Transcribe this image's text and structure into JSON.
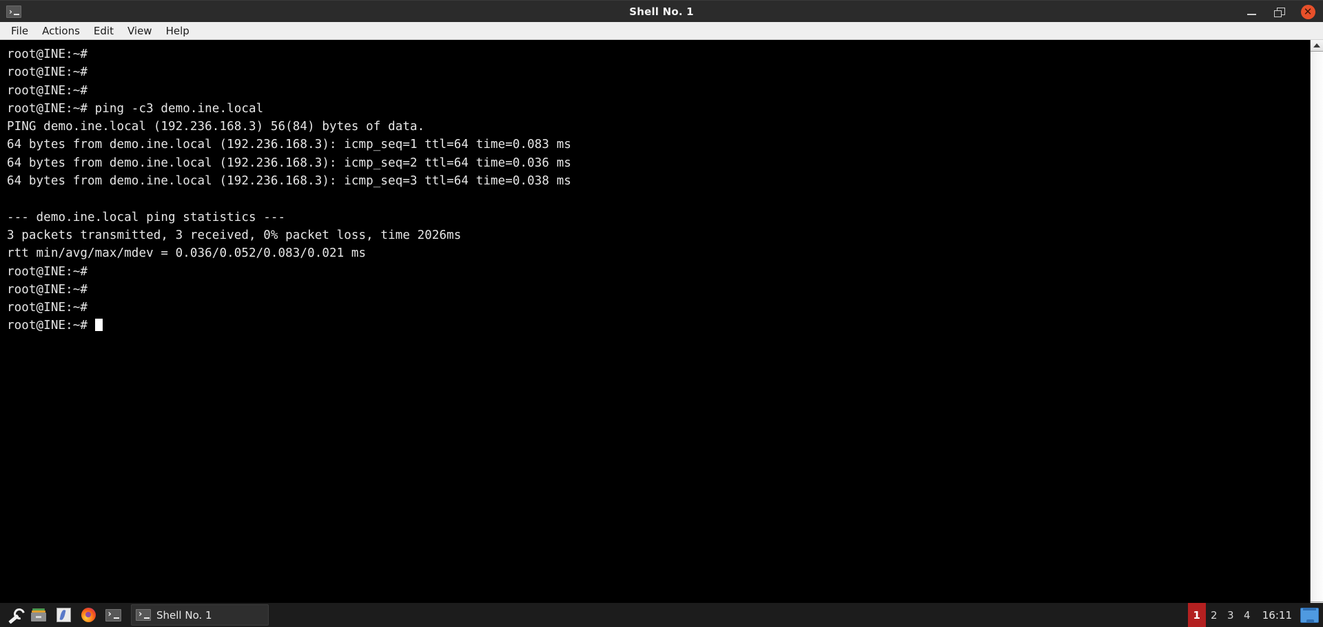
{
  "window": {
    "title": "Shell No. 1",
    "icon": "terminal-icon",
    "controls": {
      "minimize": "–",
      "maximize": "□",
      "close": "✕"
    }
  },
  "menubar": {
    "items": [
      {
        "label": "File"
      },
      {
        "label": "Actions"
      },
      {
        "label": "Edit"
      },
      {
        "label": "View"
      },
      {
        "label": "Help"
      }
    ]
  },
  "terminal": {
    "prompt": "root@INE:~#",
    "lines": [
      "root@INE:~#",
      "root@INE:~#",
      "root@INE:~#",
      "root@INE:~# ping -c3 demo.ine.local",
      "PING demo.ine.local (192.236.168.3) 56(84) bytes of data.",
      "64 bytes from demo.ine.local (192.236.168.3): icmp_seq=1 ttl=64 time=0.083 ms",
      "64 bytes from demo.ine.local (192.236.168.3): icmp_seq=2 ttl=64 time=0.036 ms",
      "64 bytes from demo.ine.local (192.236.168.3): icmp_seq=3 ttl=64 time=0.038 ms",
      "",
      "--- demo.ine.local ping statistics ---",
      "3 packets transmitted, 3 received, 0% packet loss, time 2026ms",
      "rtt min/avg/max/mdev = 0.036/0.052/0.083/0.021 ms",
      "root@INE:~#",
      "root@INE:~#",
      "root@INE:~#"
    ],
    "last_prompt": "root@INE:~# ",
    "cursor": "block"
  },
  "scrollbar": {
    "up_arrow": "scroll-up-icon",
    "down_arrow": "scroll-down-icon"
  },
  "taskbar": {
    "launchers": [
      {
        "name": "wrench-icon"
      },
      {
        "name": "file-manager-icon"
      },
      {
        "name": "text-editor-icon"
      },
      {
        "name": "firefox-icon"
      },
      {
        "name": "terminal-icon"
      }
    ],
    "task_button": {
      "label": "Shell No. 1",
      "icon": "terminal-icon"
    },
    "workspaces": [
      {
        "label": "1",
        "active": true
      },
      {
        "label": "2",
        "active": false
      },
      {
        "label": "3",
        "active": false
      },
      {
        "label": "4",
        "active": false
      }
    ],
    "clock": "16:11",
    "show_desktop": "show-desktop-icon"
  },
  "colors": {
    "titlebar_bg": "#2b2b2b",
    "menubar_bg": "#efefef",
    "terminal_bg": "#000000",
    "terminal_fg": "#e6e6e6",
    "taskbar_bg": "#1c1c1c",
    "workspace_active": "#b32020",
    "close_button": "#e8502a",
    "show_desktop": "#4f9ae0"
  }
}
